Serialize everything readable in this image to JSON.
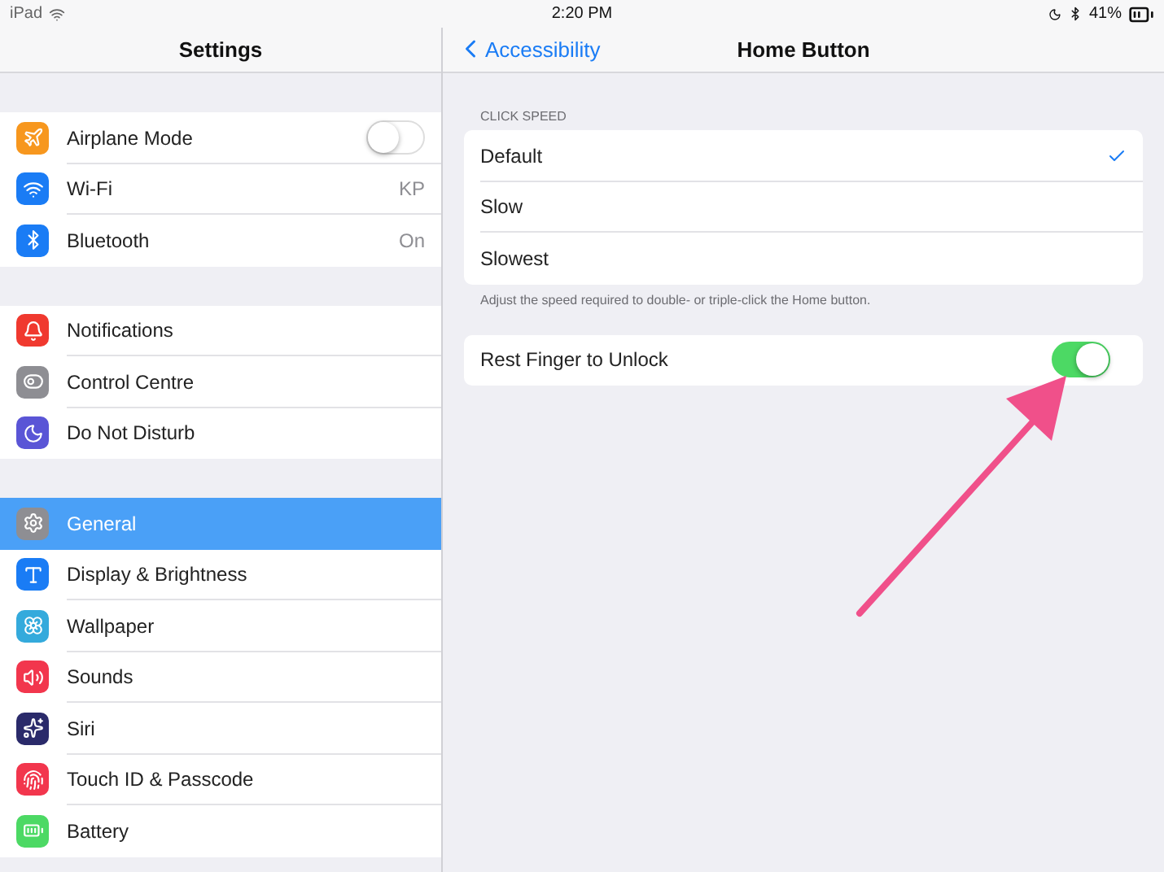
{
  "status_bar": {
    "device": "iPad",
    "time": "2:20 PM",
    "battery": "41%"
  },
  "sidebar": {
    "title": "Settings",
    "sections": [
      [
        {
          "label": "Airplane Mode",
          "color": "#f7971e",
          "kind": "toggle",
          "on": false
        },
        {
          "label": "Wi-Fi",
          "color": "#1a7cf5",
          "kind": "value",
          "value": "KP"
        },
        {
          "label": "Bluetooth",
          "color": "#1a7cf5",
          "kind": "value",
          "value": "On"
        }
      ],
      [
        {
          "label": "Notifications",
          "color": "#f0392f",
          "kind": "plain",
          "selected": false
        },
        {
          "label": "Control Centre",
          "color": "#8e8e93",
          "kind": "plain",
          "selected": false
        },
        {
          "label": "Do Not Disturb",
          "color": "#5a55d6",
          "kind": "plain",
          "selected": false
        }
      ],
      [
        {
          "label": "General",
          "color": "#8e8e93",
          "kind": "plain",
          "selected": true
        },
        {
          "label": "Display & Brightness",
          "color": "#1a7cf5",
          "kind": "plain",
          "selected": false
        },
        {
          "label": "Wallpaper",
          "color": "#34aadc",
          "kind": "plain",
          "selected": false
        },
        {
          "label": "Sounds",
          "color": "#f2364d",
          "kind": "plain",
          "selected": false
        },
        {
          "label": "Siri",
          "color": "#2a2a6a",
          "kind": "plain",
          "selected": false
        },
        {
          "label": "Touch ID & Passcode",
          "color": "#f2364d",
          "kind": "plain",
          "selected": false
        },
        {
          "label": "Battery",
          "color": "#4cd964",
          "kind": "plain",
          "selected": false
        }
      ]
    ]
  },
  "detail": {
    "back": "Accessibility",
    "title": "Home Button",
    "click_speed": {
      "header": "CLICK SPEED",
      "options": [
        {
          "label": "Default",
          "selected": true
        },
        {
          "label": "Slow",
          "selected": false
        },
        {
          "label": "Slowest",
          "selected": false
        }
      ],
      "footer": "Adjust the speed required to double- or triple-click the Home button."
    },
    "rest_finger": {
      "label": "Rest Finger to Unlock",
      "on": true
    }
  }
}
